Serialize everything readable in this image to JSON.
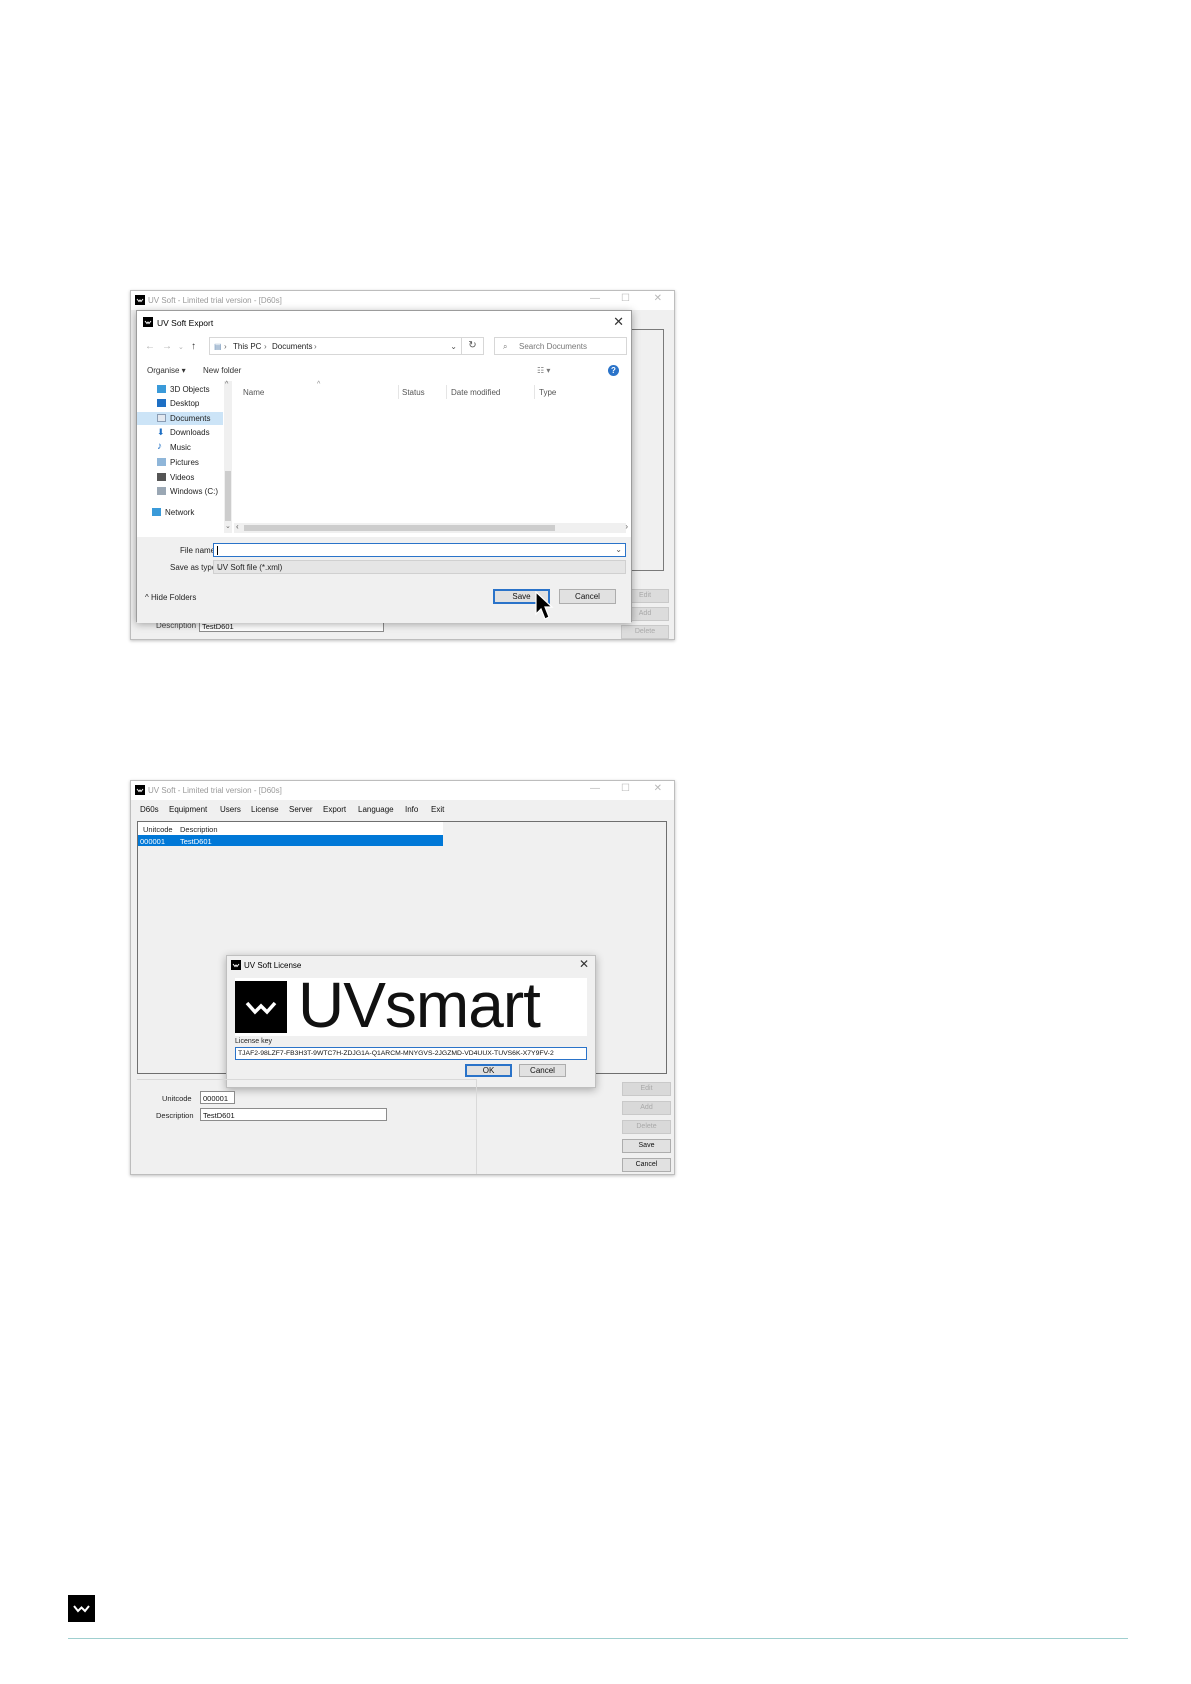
{
  "export_screenshot": {
    "window_title": "UV Soft - Limited trial version - [D60s]",
    "dialog_title": "UV Soft Export",
    "breadcrumb": [
      "This PC",
      "Documents"
    ],
    "search_placeholder": "Search Documents",
    "toolbar": {
      "organise": "Organise ▾",
      "new_folder": "New folder"
    },
    "nav_items": [
      {
        "label": "3D Objects",
        "icon": "3d-objects-icon",
        "selected": false
      },
      {
        "label": "Desktop",
        "icon": "desktop-icon",
        "selected": false
      },
      {
        "label": "Documents",
        "icon": "documents-icon",
        "selected": true
      },
      {
        "label": "Downloads",
        "icon": "downloads-icon",
        "selected": false
      },
      {
        "label": "Music",
        "icon": "music-icon",
        "selected": false
      },
      {
        "label": "Pictures",
        "icon": "pictures-icon",
        "selected": false
      },
      {
        "label": "Videos",
        "icon": "videos-icon",
        "selected": false
      },
      {
        "label": "Windows (C:)",
        "icon": "drive-icon",
        "selected": false
      },
      {
        "label": "Network",
        "icon": "network-icon",
        "selected": false
      }
    ],
    "columns": [
      "Name",
      "Status",
      "Date modified",
      "Type"
    ],
    "file_name_label": "File name:",
    "file_name_value": "",
    "save_as_type_label": "Save as type:",
    "save_as_type_value": "UV Soft file (*.xml)",
    "hide_folders": "Hide Folders",
    "save_button": "Save",
    "cancel_button": "Cancel",
    "bg_buttons": [
      "Edit",
      "Add",
      "Delete"
    ],
    "bg_description_label": "Description",
    "bg_description_value": "TestD601"
  },
  "license_screenshot": {
    "window_title": "UV Soft - Limited trial version - [D60s]",
    "menu": [
      "D60s",
      "Equipment",
      "Users",
      "License",
      "Server",
      "Export",
      "Language",
      "Info",
      "Exit"
    ],
    "list_headers": [
      "Unitcode",
      "Description"
    ],
    "list_rows": [
      {
        "unitcode": "000001",
        "description": "TestD601"
      }
    ],
    "dialog_title": "UV Soft License",
    "brand": {
      "uv": "UV",
      "smart": "smart"
    },
    "license_key_label": "License key",
    "license_key_value": "TJAF2-98LZF7-FB3H3T-9WTC7H-ZDJG1A-Q1ARCM-MNYGVS-2JGZMD-VD4UUX-TUVS6K-X7Y9FV-2",
    "ok_button": "OK",
    "cancel_button": "Cancel",
    "form": {
      "unitcode_label": "Unitcode",
      "unitcode_value": "000001",
      "description_label": "Description",
      "description_value": "TestD601"
    },
    "side_buttons": [
      {
        "label": "Edit",
        "enabled": false
      },
      {
        "label": "Add",
        "enabled": false
      },
      {
        "label": "Delete",
        "enabled": false
      },
      {
        "label": "Save",
        "enabled": true
      },
      {
        "label": "Cancel",
        "enabled": true
      }
    ]
  },
  "colors": {
    "accent": "#2a73c9",
    "selection": "#0078d7",
    "footer_line": "#9fcfcf"
  }
}
